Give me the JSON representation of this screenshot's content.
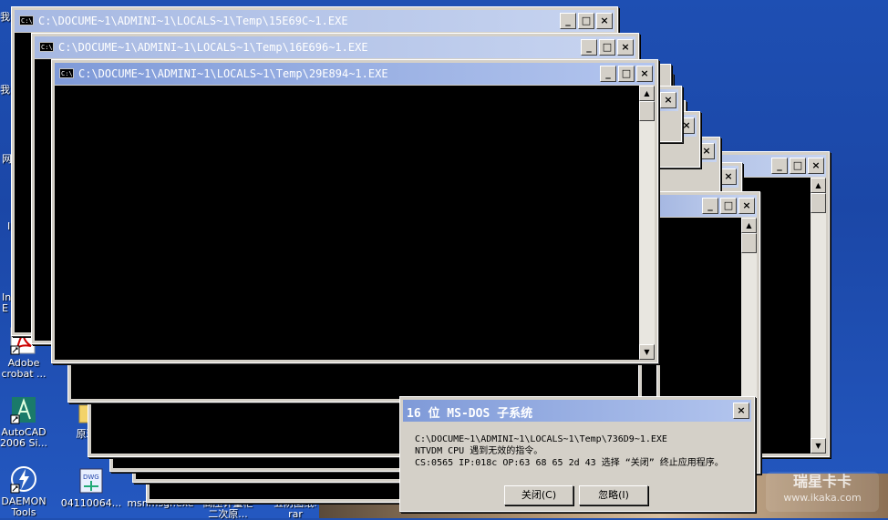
{
  "desktop": {
    "left_edge_labels": [
      "我",
      "我",
      "网",
      "I",
      "In",
      "E"
    ],
    "icons": [
      {
        "label1": "Adobe",
        "label2": "crobat ..."
      },
      {
        "label1": "AutoCAD",
        "label2": "2006 Si..."
      },
      {
        "label1": "DAEMON",
        "label2": "Tools"
      },
      {
        "label1": "原理图",
        "label2": ""
      },
      {
        "label1": "04110064...",
        "label2": ""
      },
      {
        "label1": "msnmsgr.exe",
        "label2": ""
      },
      {
        "label1": "高压计量柜",
        "label2": "二次原..."
      },
      {
        "label1": "五防图纸.",
        "label2": "rar"
      }
    ]
  },
  "windows": {
    "w1": {
      "title": "C:\\DOCUME~1\\ADMINI~1\\LOCALS~1\\Temp\\15E69C~1.EXE"
    },
    "w2": {
      "title": "C:\\DOCUME~1\\ADMINI~1\\LOCALS~1\\Temp\\16E696~1.EXE"
    },
    "w3": {
      "title": "C:\\DOCUME~1\\ADMINI~1\\LOCALS~1\\Temp\\29E894~1.EXE"
    },
    "icon_text": "C:\\",
    "min": "_",
    "max": "□",
    "close": "×",
    "up": "▲",
    "down": "▼"
  },
  "dialog": {
    "title": "16 位 MS-DOS 子系统",
    "line1": "C:\\DOCUME~1\\ADMINI~1\\LOCALS~1\\Temp\\736D9~1.EXE",
    "line2": "NTVDM CPU 遇到无效的指令。",
    "line3": "CS:0565 IP:018c OP:63 68 65 2d 43 选择 “关闭” 终止应用程序。",
    "close_btn": "关闭(C)",
    "ignore_btn": "忽略(I)",
    "x": "×"
  },
  "watermark": {
    "line1": "瑞星卡卡",
    "line2": "www.ikaka.com"
  }
}
